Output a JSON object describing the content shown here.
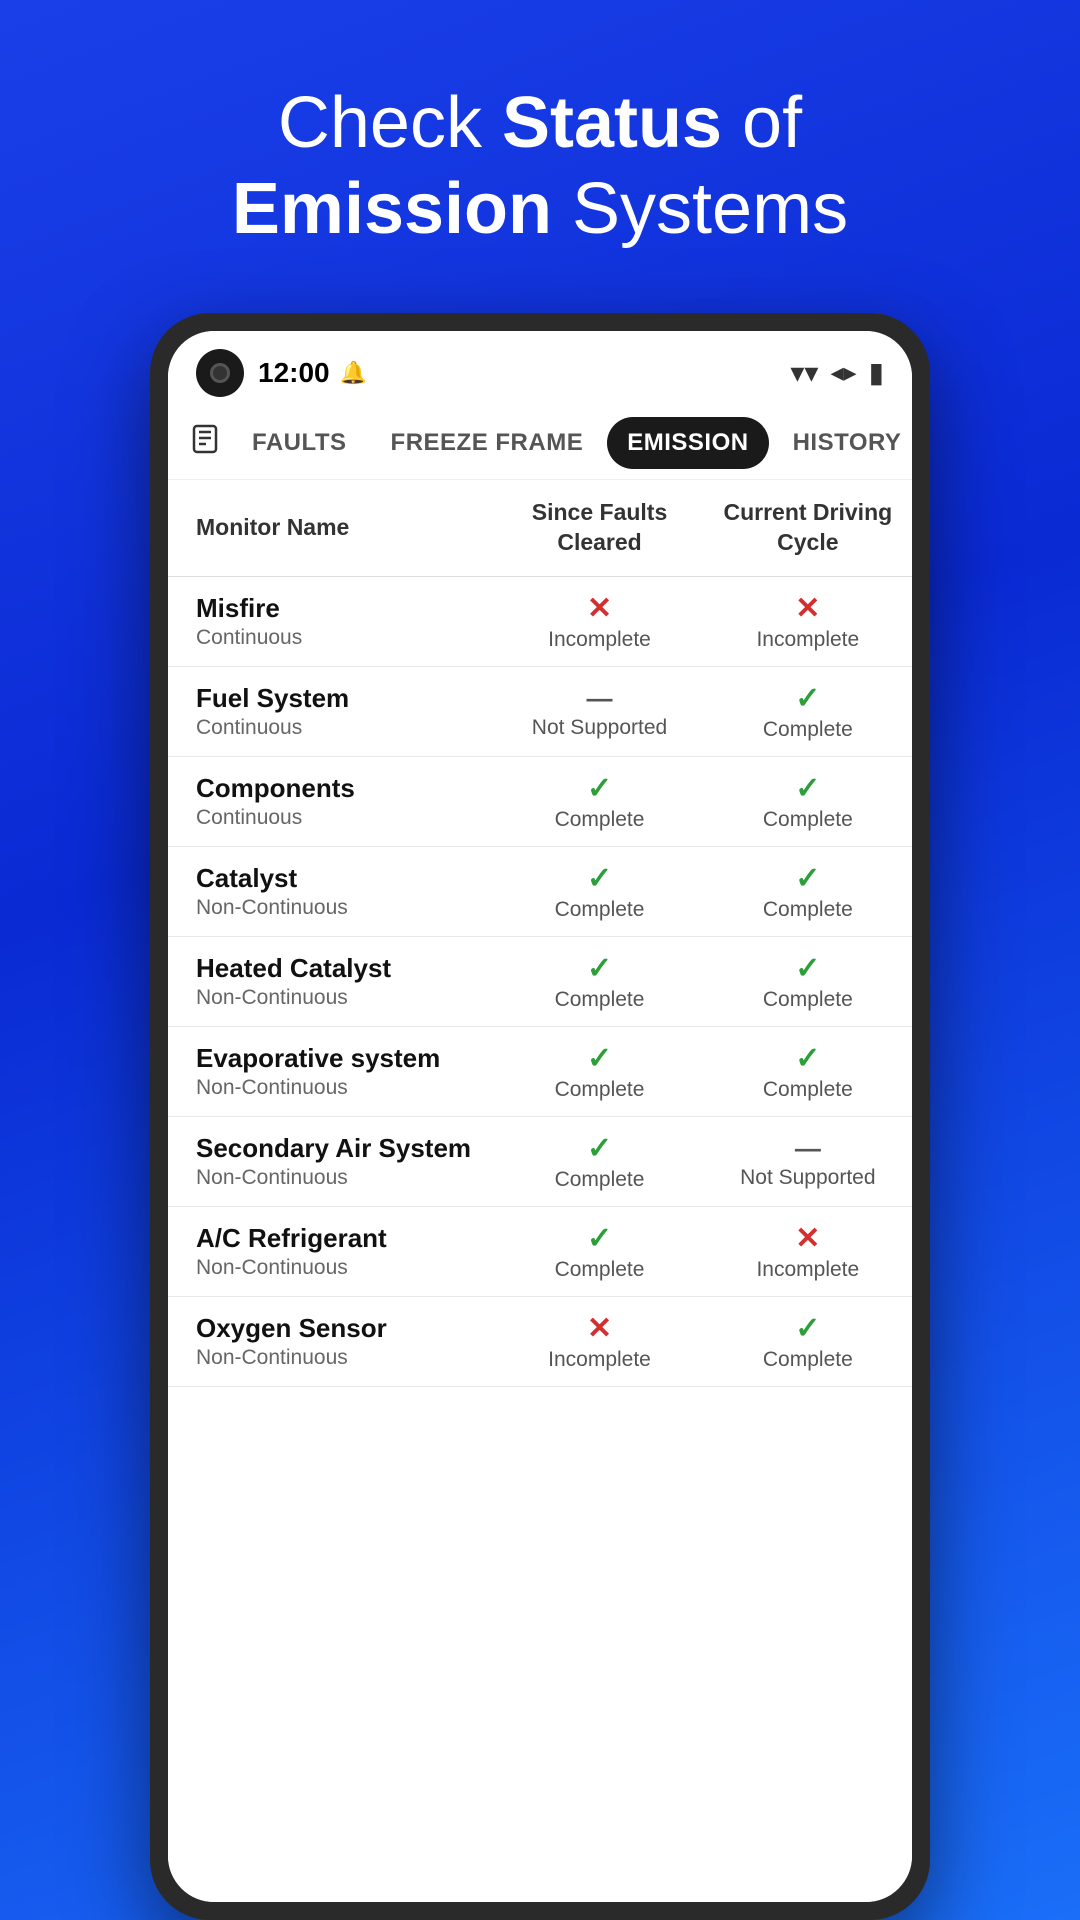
{
  "headline": {
    "line1": "Check ",
    "bold1": "Status",
    "line2": " of",
    "line3_bold": "Emission",
    "line3_rest": " Systems"
  },
  "status_bar": {
    "time": "12:00",
    "wifi": "▾",
    "battery": "▮"
  },
  "nav": {
    "icon": "⊟",
    "tabs": [
      {
        "label": "Faults",
        "active": false
      },
      {
        "label": "Freeze Frame",
        "active": false
      },
      {
        "label": "Emission",
        "active": true
      },
      {
        "label": "History",
        "active": false
      }
    ]
  },
  "table": {
    "headers": [
      "Monitor Name",
      "Since Faults\nCleared",
      "Current Driving\nCycle"
    ],
    "rows": [
      {
        "name": "Misfire",
        "type": "Continuous",
        "since": {
          "status": "incomplete",
          "icon": "✕",
          "label": "Incomplete"
        },
        "current": {
          "status": "incomplete",
          "icon": "✕",
          "label": "Incomplete"
        }
      },
      {
        "name": "Fuel System",
        "type": "Continuous",
        "since": {
          "status": "not-supported",
          "icon": "—",
          "label": "Not Supported"
        },
        "current": {
          "status": "complete",
          "icon": "✓",
          "label": "Complete"
        }
      },
      {
        "name": "Components",
        "type": "Continuous",
        "since": {
          "status": "complete",
          "icon": "✓",
          "label": "Complete"
        },
        "current": {
          "status": "complete",
          "icon": "✓",
          "label": "Complete"
        }
      },
      {
        "name": "Catalyst",
        "type": "Non-Continuous",
        "since": {
          "status": "complete",
          "icon": "✓",
          "label": "Complete"
        },
        "current": {
          "status": "complete",
          "icon": "✓",
          "label": "Complete"
        }
      },
      {
        "name": "Heated Catalyst",
        "type": "Non-Continuous",
        "since": {
          "status": "complete",
          "icon": "✓",
          "label": "Complete"
        },
        "current": {
          "status": "complete",
          "icon": "✓",
          "label": "Complete"
        }
      },
      {
        "name": "Evaporative system",
        "type": "Non-Continuous",
        "since": {
          "status": "complete",
          "icon": "✓",
          "label": "Complete"
        },
        "current": {
          "status": "complete",
          "icon": "✓",
          "label": "Complete"
        }
      },
      {
        "name": "Secondary Air System",
        "type": "Non-Continuous",
        "since": {
          "status": "complete",
          "icon": "✓",
          "label": "Complete"
        },
        "current": {
          "status": "not-supported",
          "icon": "—",
          "label": "Not Supported"
        }
      },
      {
        "name": "A/C Refrigerant",
        "type": "Non-Continuous",
        "since": {
          "status": "complete",
          "icon": "✓",
          "label": "Complete"
        },
        "current": {
          "status": "incomplete",
          "icon": "✕",
          "label": "Incomplete"
        }
      },
      {
        "name": "Oxygen Sensor",
        "type": "Non-Continuous",
        "since": {
          "status": "incomplete",
          "icon": "✕",
          "label": "Incomplete"
        },
        "current": {
          "status": "complete",
          "icon": "✓",
          "label": "Complete"
        }
      }
    ]
  }
}
